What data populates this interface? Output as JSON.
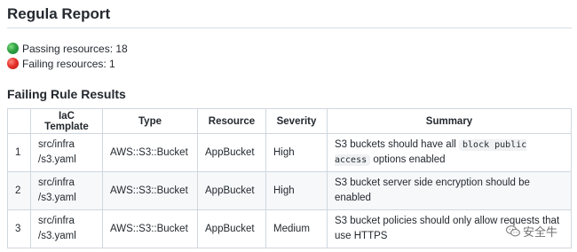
{
  "report": {
    "title": "Regula Report",
    "passing": "Passing resources: 18",
    "failing": "Failing resources: 1",
    "section_title": "Failing Rule Results"
  },
  "colors": {
    "pass": "#2ea043",
    "fail": "#e5322b",
    "border": "#d0d7de",
    "alt_row": "#f6f8fa"
  },
  "table": {
    "headers": [
      "",
      "IaC Template",
      "Type",
      "Resource",
      "Severity",
      "Summary"
    ],
    "rows": [
      {
        "num": "1",
        "template_line1": "src/infra",
        "template_line2": "/s3.yaml",
        "type": "AWS::S3::Bucket",
        "resource": "AppBucket",
        "severity": "High",
        "summary_pre": "S3 buckets should have all ",
        "summary_code": "block public access",
        "summary_post": " options enabled"
      },
      {
        "num": "2",
        "template_line1": "src/infra",
        "template_line2": "/s3.yaml",
        "type": "AWS::S3::Bucket",
        "resource": "AppBucket",
        "severity": "High",
        "summary": "S3 bucket server side encryption should be enabled"
      },
      {
        "num": "3",
        "template_line1": "src/infra",
        "template_line2": "/s3.yaml",
        "type": "AWS::S3::Bucket",
        "resource": "AppBucket",
        "severity": "Medium",
        "summary": "S3 bucket policies should only allow requests that use HTTPS"
      }
    ]
  },
  "watermark": {
    "text": "安全牛",
    "icon": "wechat-icon"
  }
}
